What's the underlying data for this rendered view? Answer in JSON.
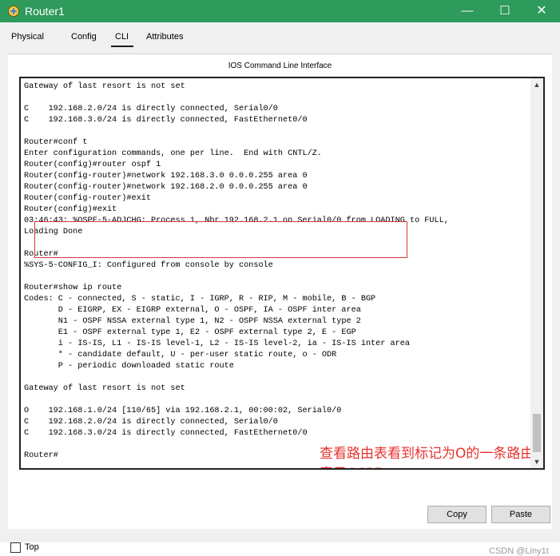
{
  "window": {
    "title": "Router1",
    "minimize_glyph": "—",
    "maximize_glyph": "☐",
    "close_glyph": "✕",
    "accent": "#2e9a5c"
  },
  "tabs": [
    {
      "label": "Physical"
    },
    {
      "label": "Config"
    },
    {
      "label": "CLI",
      "active": true
    },
    {
      "label": "Attributes"
    }
  ],
  "cli": {
    "panel_title": "IOS Command Line Interface",
    "lines": [
      "Gateway of last resort is not set",
      "",
      "C    192.168.2.0/24 is directly connected, Serial0/0",
      "C    192.168.3.0/24 is directly connected, FastEthernet0/0",
      "",
      "Router#conf t",
      "Enter configuration commands, one per line.  End with CNTL/Z.",
      "Router(config)#router ospf 1",
      "Router(config-router)#network 192.168.3.0 0.0.0.255 area 0",
      "Router(config-router)#network 192.168.2.0 0.0.0.255 area 0",
      "Router(config-router)#exit",
      "Router(config)#exit",
      "03:46:43: %OSPF-5-ADJCHG: Process 1, Nbr 192.168.2.1 on Serial0/0 from LOADING to FULL,",
      "Loading Done",
      "",
      "Router#",
      "%SYS-5-CONFIG_I: Configured from console by console",
      "",
      "Router#show ip route",
      "Codes: C - connected, S - static, I - IGRP, R - RIP, M - mobile, B - BGP",
      "       D - EIGRP, EX - EIGRP external, O - OSPF, IA - OSPF inter area",
      "       N1 - OSPF NSSA external type 1, N2 - OSPF NSSA external type 2",
      "       E1 - OSPF external type 1, E2 - OSPF external type 2, E - EGP",
      "       i - IS-IS, L1 - IS-IS level-1, L2 - IS-IS level-2, ia - IS-IS inter area",
      "       * - candidate default, U - per-user static route, o - ODR",
      "       P - periodic downloaded static route",
      "",
      "Gateway of last resort is not set",
      "",
      "O    192.168.1.0/24 [110/65] via 192.168.2.1, 00:00:02, Serial0/0",
      "C    192.168.2.0/24 is directly connected, Serial0/0",
      "C    192.168.3.0/24 is directly connected, FastEthernet0/0",
      "",
      "Router#"
    ],
    "annotation_text": "查看路由表看到标记为O的一条路由，O表示OSPF",
    "annotation_color": "#e8322f",
    "highlight_color": "#d9363e"
  },
  "buttons": {
    "copy": "Copy",
    "paste": "Paste"
  },
  "footer": {
    "top_label": "Top",
    "top_checked": false,
    "watermark": "CSDN @Liny1t"
  }
}
